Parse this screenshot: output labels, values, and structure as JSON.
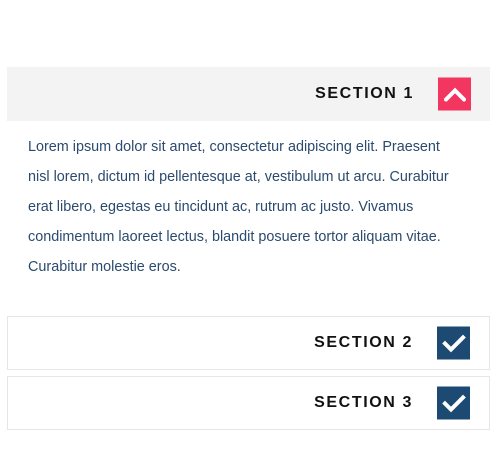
{
  "colors": {
    "open_toggle": "#f2365f",
    "closed_toggle": "#1d4a73",
    "open_header_bg": "#f3f3f3",
    "body_text": "#2a4a6e"
  },
  "sections": [
    {
      "title": "SECTION 1",
      "state": "expanded",
      "icon": "chevron-up-icon",
      "body": "Lorem ipsum dolor sit amet, consectetur adipiscing elit. Praesent nisl lorem, dictum id pellentesque at, vestibulum ut arcu. Curabitur erat libero, egestas eu tincidunt ac, rutrum ac justo. Vivamus condimentum laoreet lectus, blandit posuere tortor aliquam vitae. Curabitur molestie eros."
    },
    {
      "title": "SECTION 2",
      "state": "collapsed",
      "icon": "checkmark-icon"
    },
    {
      "title": "SECTION 3",
      "state": "collapsed",
      "icon": "checkmark-icon"
    }
  ]
}
